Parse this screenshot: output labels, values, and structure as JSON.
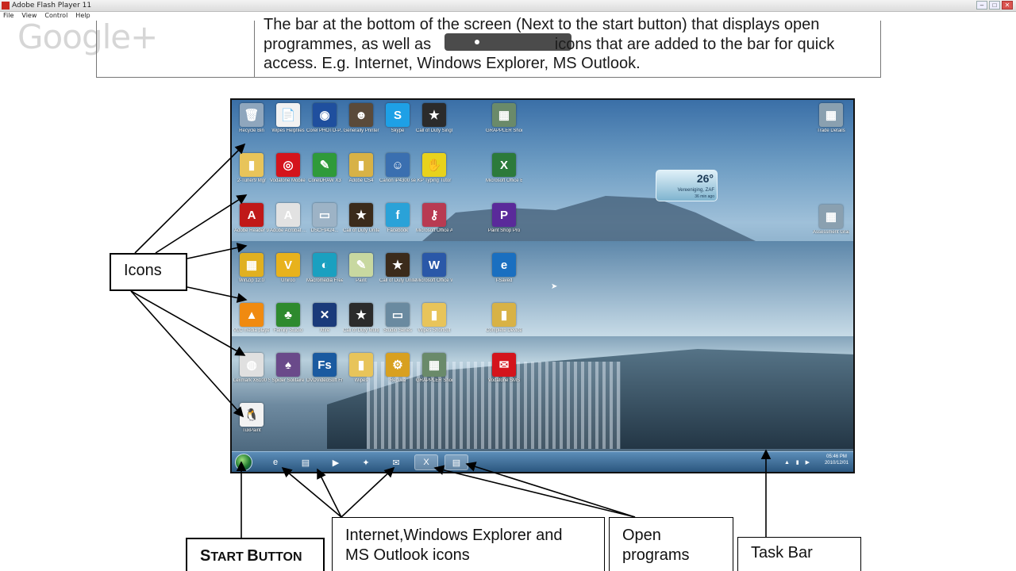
{
  "window": {
    "title": "Adobe Flash Player 11",
    "menu": [
      "File",
      "View",
      "Control",
      "Help"
    ],
    "buttons": [
      "–",
      "□",
      "✕"
    ]
  },
  "watermark": "Google+",
  "document": {
    "line1": "The bar at the bottom of the screen (Next to the start button) that displays open",
    "line2_a": "programmes, as well as ",
    "line2_b": "icons that are added to the bar for quick",
    "line3": "access. E.g. Internet, Windows Explorer, MS Outlook."
  },
  "desktop": {
    "icons": [
      {
        "label": "Recycle Bin",
        "glyph": "🗑",
        "color": "#8fa6bd"
      },
      {
        "label": "Wipes Helpfiles",
        "glyph": "📄",
        "color": "#f2f2f2"
      },
      {
        "label": "Corel PHOTO-P...",
        "glyph": "◉",
        "color": "#1f4f9e"
      },
      {
        "label": "Generally Printer",
        "glyph": "☻",
        "color": "#5a4a3a"
      },
      {
        "label": "Skype",
        "glyph": "S",
        "color": "#1ea0e6"
      },
      {
        "label": "Call of Duty Single Player",
        "glyph": "★",
        "color": "#2b2b2b"
      },
      {
        "label": "GRAPPLER Shortcut",
        "glyph": "▦",
        "color": "#6a8a6a"
      },
      {
        "label": "2-Tuner9 Mgr",
        "glyph": "▮",
        "color": "#e8c45a"
      },
      {
        "label": "Vodafone Mobile ...",
        "glyph": "◎",
        "color": "#d4141c"
      },
      {
        "label": "CorelDRAW X3",
        "glyph": "✎",
        "color": "#2f9a3a"
      },
      {
        "label": "Adobe CS4",
        "glyph": "▮",
        "color": "#d8b246"
      },
      {
        "label": "Canon iP4300 sett...",
        "glyph": "☺",
        "color": "#3a6fb0"
      },
      {
        "label": "KP Typing Tutor",
        "glyph": "✋",
        "color": "#e8d21c"
      },
      {
        "label": "Microsoft Office Ex...",
        "glyph": "X",
        "color": "#2c7a3b"
      },
      {
        "label": "Adobe Reader 9",
        "glyph": "A",
        "color": "#c01818"
      },
      {
        "label": "Adobe Acrobat ...",
        "glyph": "A",
        "color": "#e2e2e2"
      },
      {
        "label": "DSCF9424...",
        "glyph": "▭",
        "color": "#9db3c6"
      },
      {
        "label": "Call of Duty United Off...",
        "glyph": "★",
        "color": "#3b2b1b"
      },
      {
        "label": "Facebook",
        "glyph": "f",
        "color": "#2aa2d8"
      },
      {
        "label": "Microsoft Office Acce...",
        "glyph": "⚷",
        "color": "#b83a52"
      },
      {
        "label": "Paint Shop Pro",
        "glyph": "P",
        "color": "#5a2a9a"
      },
      {
        "label": "WinZip 12.0",
        "glyph": "▦",
        "color": "#e0b020"
      },
      {
        "label": "Uniroo",
        "glyph": "V",
        "color": "#e8b21c"
      },
      {
        "label": "Macromedia FreeHand ...",
        "glyph": "◐",
        "color": "#1aa0c0"
      },
      {
        "label": "Paint",
        "glyph": "✎",
        "color": "#c8d8a0"
      },
      {
        "label": "Call of Duty United Off...",
        "glyph": "★",
        "color": "#3b2b1b"
      },
      {
        "label": "Microsoft Office Word 2007",
        "glyph": "W",
        "color": "#2a58a8"
      },
      {
        "label": "I-Saved",
        "glyph": "e",
        "color": "#1a6fc0"
      },
      {
        "label": "VLC media player",
        "glyph": "▲",
        "color": "#f08a10"
      },
      {
        "label": "Family Studio",
        "glyph": "♣",
        "color": "#2e8a2e"
      },
      {
        "label": "Xfire",
        "glyph": "✕",
        "color": "#1a3a7a"
      },
      {
        "label": "Call of Duty Multiplayer",
        "glyph": "★",
        "color": "#2b2b2b"
      },
      {
        "label": "Studio Series",
        "glyph": "▭",
        "color": "#6a8aa0"
      },
      {
        "label": "Wipes Shortcut",
        "glyph": "▮",
        "color": "#e8c45a"
      },
      {
        "label": "Complete Devices ...",
        "glyph": "▮",
        "color": "#d8b246"
      },
      {
        "label": "Lexmark X6100 Seri...",
        "glyph": "◍",
        "color": "#e0e0e0"
      },
      {
        "label": "Spider Solitaire",
        "glyph": "♠",
        "color": "#6a4a8a"
      },
      {
        "label": "DVDVideoSoft Free Studio",
        "glyph": "Fs",
        "color": "#1a5aa0"
      },
      {
        "label": "Wipes",
        "glyph": "▮",
        "color": "#e8c45a"
      },
      {
        "label": "Recuva",
        "glyph": "⚙",
        "color": "#d8a020"
      },
      {
        "label": "GRAPPLER Shortcut",
        "glyph": "▦",
        "color": "#6a8a6a"
      },
      {
        "label": "Vodafone SMS",
        "glyph": "✉",
        "color": "#d4141c"
      },
      {
        "label": "TuxPaint",
        "glyph": "🐧",
        "color": "#f2f2f2"
      }
    ],
    "right_icons": [
      {
        "label": "Trade Details",
        "glyph": "▦",
        "color": "#8aa0b0"
      },
      {
        "label": "Assessment Grade 10-1...",
        "glyph": "▦",
        "color": "#8aa0b0"
      }
    ],
    "weather": {
      "temp": "26°",
      "place": "Vereeniging, ZAF",
      "ago": "36 min ago"
    },
    "taskbar": {
      "items": [
        {
          "name": "internet-explorer",
          "glyph": "e",
          "active": false
        },
        {
          "name": "windows-explorer",
          "glyph": "▤",
          "active": false
        },
        {
          "name": "media-player",
          "glyph": "▶",
          "active": false
        },
        {
          "name": "msn",
          "glyph": "✦",
          "active": false
        },
        {
          "name": "outlook",
          "glyph": "✉",
          "active": false
        },
        {
          "name": "excel",
          "glyph": "X",
          "active": true
        },
        {
          "name": "document",
          "glyph": "▤",
          "active": true
        }
      ],
      "time": "05:46 PM",
      "date": "2010/12/01",
      "tray": "▲ ▮ ▶"
    }
  },
  "callouts": {
    "icons": "Icons",
    "start_s": "S",
    "start_rest": "TART ",
    "start_b": "B",
    "start_rest2": "UTTON",
    "iwe_line1": "Internet,Windows Explorer  and",
    "iwe_line2": "MS Outlook icons",
    "open_line1": "Open",
    "open_line2": "programs",
    "taskbar": "Task Bar"
  }
}
